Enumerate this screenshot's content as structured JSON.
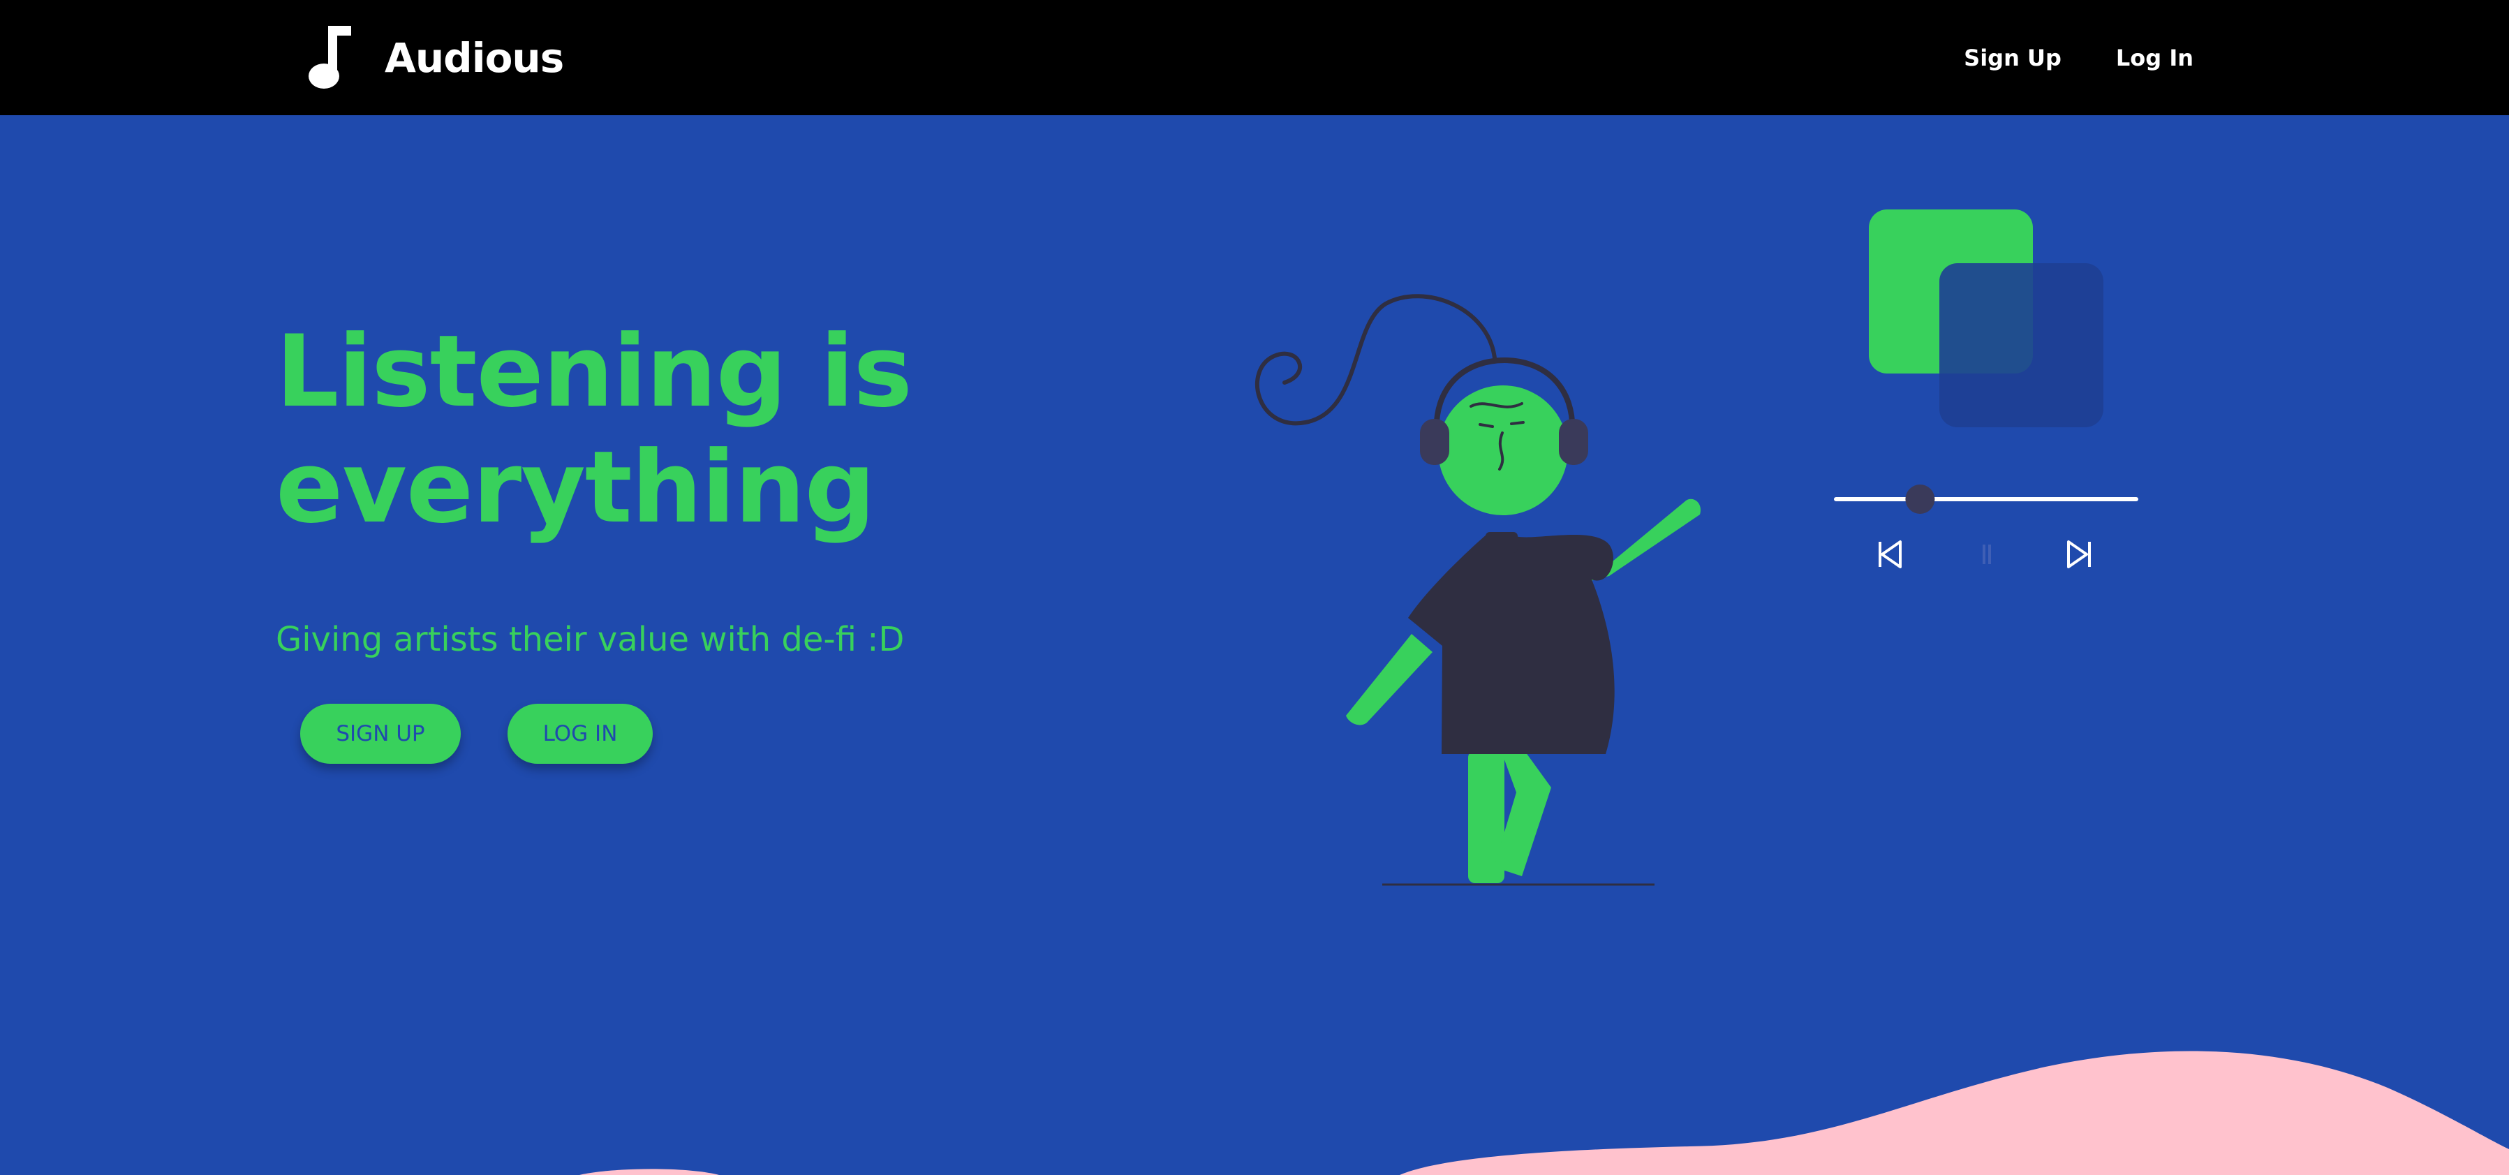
{
  "navbar": {
    "brand": {
      "name": "Audious",
      "icon": "music-note-icon"
    },
    "links": {
      "signup": "Sign Up",
      "login": "Log In"
    }
  },
  "hero": {
    "headline_line1": "Listening is",
    "headline_line2": "everything",
    "tagline": "Giving artists their value with de-fi :D",
    "buttons": {
      "signup": "SIGN UP",
      "login": "LOG IN"
    }
  },
  "player": {
    "progress": 0.28,
    "icons": {
      "previous": "skip-previous-icon",
      "pause": "pause-icon",
      "next": "skip-next-icon"
    }
  },
  "colors": {
    "background": "#1f4aad",
    "navbar": "#000000",
    "accent_green": "#38d15c",
    "dark_figure": "#2f2e41",
    "wave_pink": "#ffc2cd",
    "white": "#ffffff"
  }
}
